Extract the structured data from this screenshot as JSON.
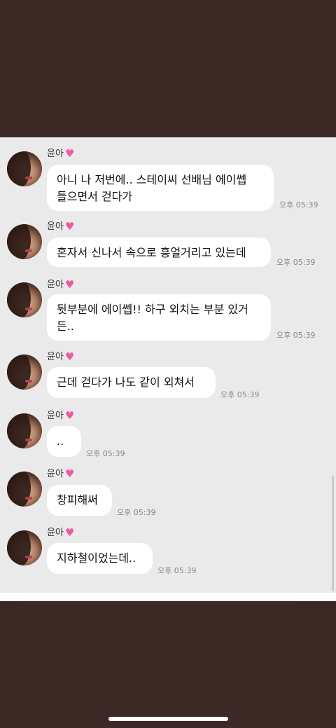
{
  "colors": {
    "frame_background": "#3c2825",
    "chat_background": "#eaeaea",
    "bubble_background": "#ffffff",
    "heart": "#ec5aa6"
  },
  "messages": [
    {
      "sender": "윤아",
      "sender_icon": "pink-heart-icon",
      "lines": [
        "아니 나 저번에.. 스테이씨 선배님 에이쎕",
        "들으면서 걷다가"
      ],
      "time": "오후 05:39"
    },
    {
      "sender": "윤아",
      "sender_icon": "pink-heart-icon",
      "lines": [
        "혼자서 신나서 속으로 흥얼거리고 있는데"
      ],
      "time": "오후 05:39"
    },
    {
      "sender": "윤아",
      "sender_icon": "pink-heart-icon",
      "lines": [
        "뒷부분에 에이쎕!! 하구 외치는 부분 있거",
        "든.."
      ],
      "time": "오후 05:39"
    },
    {
      "sender": "윤아",
      "sender_icon": "pink-heart-icon",
      "lines": [
        "근데 걷다가 나도 같이 외쳐서"
      ],
      "time": "오후 05:39"
    },
    {
      "sender": "윤아",
      "sender_icon": "pink-heart-icon",
      "lines": [
        ".."
      ],
      "time": "오후 05:39"
    },
    {
      "sender": "윤아",
      "sender_icon": "pink-heart-icon",
      "lines": [
        "창피해써"
      ],
      "time": "오후 05:39"
    },
    {
      "sender": "윤아",
      "sender_icon": "pink-heart-icon",
      "lines": [
        "지하철이었는데.."
      ],
      "time": "오후 05:39"
    }
  ]
}
